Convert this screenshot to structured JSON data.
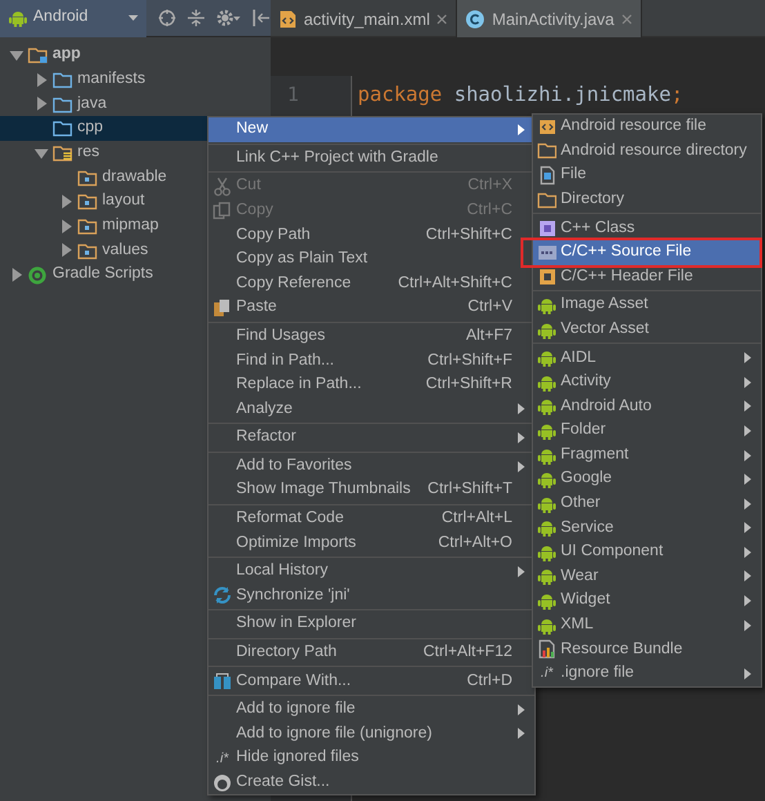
{
  "toolbar": {
    "view": "Android"
  },
  "tree": [
    {
      "label": "app",
      "kind": "module",
      "expanded": true,
      "selected": false,
      "children": [
        {
          "label": "manifests",
          "kind": "folder",
          "expanded": false,
          "selected": false
        },
        {
          "label": "java",
          "kind": "folder",
          "expanded": false,
          "selected": false
        },
        {
          "label": "cpp",
          "kind": "folder",
          "selected": true
        },
        {
          "label": "res",
          "kind": "resources",
          "expanded": true,
          "selected": false,
          "children": [
            {
              "label": "drawable",
              "kind": "resource-folder",
              "selected": false
            },
            {
              "label": "layout",
              "kind": "resource-folder",
              "expanded": false,
              "selected": false
            },
            {
              "label": "mipmap",
              "kind": "resource-folder",
              "expanded": false,
              "selected": false
            },
            {
              "label": "values",
              "kind": "resource-folder",
              "expanded": false,
              "selected": false
            }
          ]
        }
      ]
    },
    {
      "label": "Gradle Scripts",
      "kind": "gradle",
      "expanded": false,
      "selected": false
    }
  ],
  "tabs": [
    {
      "label": "activity_main.xml",
      "kind": "xml",
      "selected": false
    },
    {
      "label": "MainActivity.java",
      "kind": "class",
      "selected": true
    }
  ],
  "editor": {
    "line_number": "1",
    "code": [
      {
        "text": "package",
        "kind": "keyword"
      },
      {
        "text": " shaolizhi.jnicmake",
        "kind": "plain"
      },
      {
        "text": ";",
        "kind": "keyword"
      }
    ]
  },
  "context_menu": {
    "groups": [
      [
        {
          "label": "New",
          "submenu": true,
          "selected": true,
          "disabled": false
        }
      ],
      [
        {
          "label": "Link C++ Project with Gradle",
          "selected": false,
          "disabled": false
        }
      ],
      [
        {
          "label": "Cut",
          "shortcut": "Ctrl+X",
          "selected": false,
          "disabled": true
        },
        {
          "label": "Copy",
          "shortcut": "Ctrl+C",
          "selected": false,
          "disabled": true
        },
        {
          "label": "Copy Path",
          "shortcut": "Ctrl+Shift+C",
          "selected": false,
          "disabled": false
        },
        {
          "label": "Copy as Plain Text",
          "selected": false,
          "disabled": false
        },
        {
          "label": "Copy Reference",
          "shortcut": "Ctrl+Alt+Shift+C",
          "selected": false,
          "disabled": false
        },
        {
          "label": "Paste",
          "shortcut": "Ctrl+V",
          "selected": false,
          "disabled": false
        }
      ],
      [
        {
          "label": "Find Usages",
          "shortcut": "Alt+F7",
          "selected": false,
          "disabled": false
        },
        {
          "label": "Find in Path...",
          "shortcut": "Ctrl+Shift+F",
          "selected": false,
          "disabled": false
        },
        {
          "label": "Replace in Path...",
          "shortcut": "Ctrl+Shift+R",
          "selected": false,
          "disabled": false
        },
        {
          "label": "Analyze",
          "submenu": true,
          "selected": false,
          "disabled": false
        }
      ],
      [
        {
          "label": "Refactor",
          "submenu": true,
          "selected": false,
          "disabled": false
        }
      ],
      [
        {
          "label": "Add to Favorites",
          "submenu": true,
          "selected": false,
          "disabled": false
        },
        {
          "label": "Show Image Thumbnails",
          "shortcut": "Ctrl+Shift+T",
          "selected": false,
          "disabled": false
        }
      ],
      [
        {
          "label": "Reformat Code",
          "shortcut": "Ctrl+Alt+L",
          "selected": false,
          "disabled": false
        },
        {
          "label": "Optimize Imports",
          "shortcut": "Ctrl+Alt+O",
          "selected": false,
          "disabled": false
        }
      ],
      [
        {
          "label": "Local History",
          "submenu": true,
          "selected": false,
          "disabled": false
        },
        {
          "label": "Synchronize 'jni'",
          "selected": false,
          "disabled": false
        }
      ],
      [
        {
          "label": "Show in Explorer",
          "selected": false,
          "disabled": false
        }
      ],
      [
        {
          "label": "Directory Path",
          "shortcut": "Ctrl+Alt+F12",
          "selected": false,
          "disabled": false
        }
      ],
      [
        {
          "label": "Compare With...",
          "shortcut": "Ctrl+D",
          "selected": false,
          "disabled": false
        }
      ],
      [
        {
          "label": "Add to ignore file",
          "submenu": true,
          "selected": false,
          "disabled": false
        },
        {
          "label": "Add to ignore file (unignore)",
          "submenu": true,
          "selected": false,
          "disabled": false
        },
        {
          "label": "Hide ignored files",
          "prefix": ".i*",
          "selected": false,
          "disabled": false
        },
        {
          "label": "Create Gist...",
          "selected": false,
          "disabled": false
        }
      ]
    ]
  },
  "new_submenu": {
    "groups": [
      [
        {
          "label": "Android resource file",
          "selected": false
        },
        {
          "label": "Android resource directory",
          "selected": false
        },
        {
          "label": "File",
          "selected": false
        },
        {
          "label": "Directory",
          "selected": false
        }
      ],
      [
        {
          "label": "C++ Class",
          "selected": false
        },
        {
          "label": "C/C++ Source File",
          "selected": true,
          "outlined": true
        },
        {
          "label": "C/C++ Header File",
          "selected": false
        }
      ],
      [
        {
          "label": "Image Asset",
          "selected": false
        },
        {
          "label": "Vector Asset",
          "selected": false
        }
      ],
      [
        {
          "label": "AIDL",
          "submenu": true,
          "selected": false
        },
        {
          "label": "Activity",
          "submenu": true,
          "selected": false
        },
        {
          "label": "Android Auto",
          "submenu": true,
          "selected": false
        },
        {
          "label": "Folder",
          "submenu": true,
          "selected": false
        },
        {
          "label": "Fragment",
          "submenu": true,
          "selected": false
        },
        {
          "label": "Google",
          "submenu": true,
          "selected": false
        },
        {
          "label": "Other",
          "submenu": true,
          "selected": false
        },
        {
          "label": "Service",
          "submenu": true,
          "selected": false
        },
        {
          "label": "UI Component",
          "submenu": true,
          "selected": false
        },
        {
          "label": "Wear",
          "submenu": true,
          "selected": false
        },
        {
          "label": "Widget",
          "submenu": true,
          "selected": false
        },
        {
          "label": "XML",
          "submenu": true,
          "selected": false
        },
        {
          "label": "Resource Bundle",
          "selected": false
        },
        {
          "label": ".ignore file",
          "prefix": ".i*",
          "submenu": true,
          "selected": false
        }
      ]
    ]
  }
}
